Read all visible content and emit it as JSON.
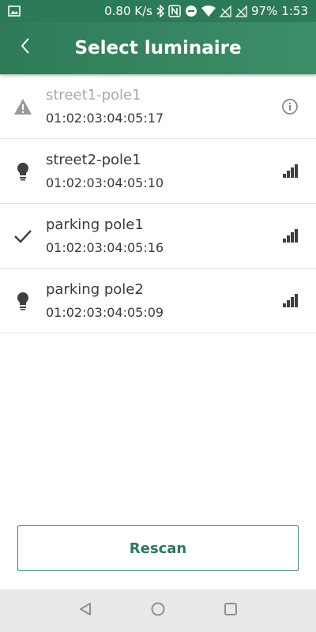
{
  "status_bar": {
    "speed": "0.80 K/s",
    "battery": "97%",
    "time": "1:53"
  },
  "header": {
    "title": "Select luminaire",
    "back_icon": "chevron-left-icon"
  },
  "luminaires": [
    {
      "name": "street1-pole1",
      "mac": "01:02:03:04:05:17",
      "lead_icon": "warning-icon",
      "trail_icon": "info-icon",
      "state": "disabled"
    },
    {
      "name": "street2-pole1",
      "mac": "01:02:03:04:05:10",
      "lead_icon": "lightbulb-icon",
      "trail_icon": "signal-strength-icon",
      "state": "normal"
    },
    {
      "name": "parking pole1",
      "mac": "01:02:03:04:05:16",
      "lead_icon": "checkmark-icon",
      "trail_icon": "signal-strength-icon",
      "state": "selected"
    },
    {
      "name": "parking pole2",
      "mac": "01:02:03:04:05:09",
      "lead_icon": "lightbulb-icon",
      "trail_icon": "signal-strength-icon",
      "state": "normal"
    }
  ],
  "actions": {
    "rescan_label": "Rescan"
  },
  "colors": {
    "accent": "#2d7a57",
    "text": "#3a3a3a",
    "disabled_text": "#a9a9a9",
    "divider": "#e2e2e2"
  }
}
